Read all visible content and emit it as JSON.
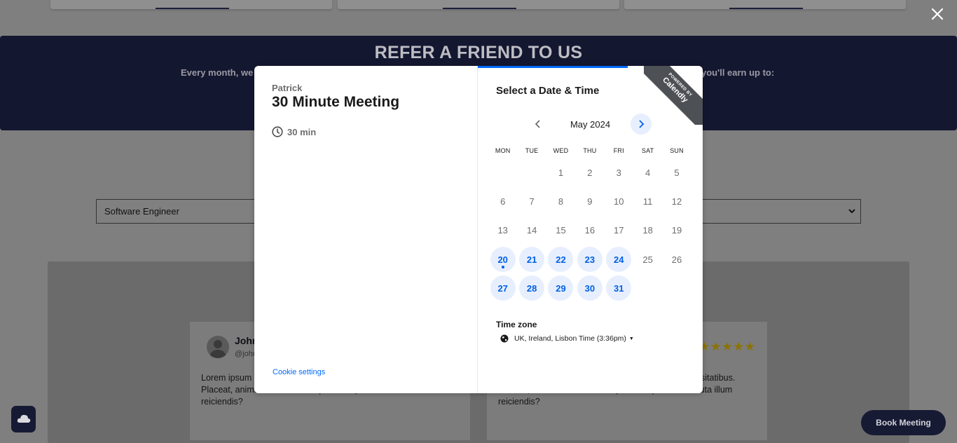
{
  "background": {
    "refer_title": "REFER A FRIEND TO US",
    "refer_sub_left": "Every month, we",
    "refer_sub_right": "you'll earn up to:",
    "job_select_value": "Software Engineer",
    "testimonials": [
      {
        "name": "John",
        "handle": "@john",
        "text": "Lorem ipsum commodi asp suscipit totam ducimus necessitatibus. Placeat, animi dolorum consequatur adipisci odit soluta illum reiciendis?"
      },
      {
        "stars": "★★★★★",
        "text": "ng elit. Facilis de illum suscipit totam ducimus necessitatibus. Placeat, animi dolorum consequatur adipisci odit soluta illum reiciendis?"
      }
    ],
    "book_meeting_label": "Book Meeting"
  },
  "modal": {
    "organizer": "Patrick",
    "event_title": "30 Minute Meeting",
    "duration": "30 min",
    "cookie_settings": "Cookie settings",
    "select_title": "Select a Date & Time",
    "badge_small": "POWERED BY",
    "badge_big": "Calendly",
    "month_label": "May 2024",
    "weekdays": [
      "MON",
      "TUE",
      "WED",
      "THU",
      "FRI",
      "SAT",
      "SUN"
    ],
    "leading_blanks": 2,
    "days": [
      {
        "n": "1",
        "available": false
      },
      {
        "n": "2",
        "available": false
      },
      {
        "n": "3",
        "available": false
      },
      {
        "n": "4",
        "available": false
      },
      {
        "n": "5",
        "available": false
      },
      {
        "n": "6",
        "available": false
      },
      {
        "n": "7",
        "available": false
      },
      {
        "n": "8",
        "available": false
      },
      {
        "n": "9",
        "available": false
      },
      {
        "n": "10",
        "available": false
      },
      {
        "n": "11",
        "available": false
      },
      {
        "n": "12",
        "available": false
      },
      {
        "n": "13",
        "available": false
      },
      {
        "n": "14",
        "available": false
      },
      {
        "n": "15",
        "available": false
      },
      {
        "n": "16",
        "available": false
      },
      {
        "n": "17",
        "available": false
      },
      {
        "n": "18",
        "available": false
      },
      {
        "n": "19",
        "available": false
      },
      {
        "n": "20",
        "available": true,
        "today": true
      },
      {
        "n": "21",
        "available": true
      },
      {
        "n": "22",
        "available": true
      },
      {
        "n": "23",
        "available": true
      },
      {
        "n": "24",
        "available": true
      },
      {
        "n": "25",
        "available": false
      },
      {
        "n": "26",
        "available": false
      },
      {
        "n": "27",
        "available": true
      },
      {
        "n": "28",
        "available": true
      },
      {
        "n": "29",
        "available": true
      },
      {
        "n": "30",
        "available": true
      },
      {
        "n": "31",
        "available": true
      }
    ],
    "timezone_title": "Time zone",
    "timezone_value": "UK, Ireland, Lisbon Time (3:36pm)"
  },
  "colors": {
    "accent": "#0069ff",
    "available_bg": "#e7effe",
    "navy": "#161a33"
  },
  "icons": [
    "close-icon",
    "clock-icon",
    "chevron-left-icon",
    "chevron-right-icon",
    "globe-icon",
    "cloud-upload-icon",
    "chevron-down-icon"
  ]
}
